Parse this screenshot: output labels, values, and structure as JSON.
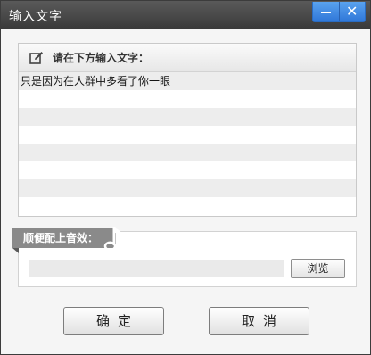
{
  "window": {
    "title": "输入文字",
    "minimize_icon": "minimize-icon",
    "close_icon": "close-icon",
    "accent": "#3a86e0"
  },
  "text_panel": {
    "header_icon": "edit-icon",
    "header_label": "请在下方输入文字：",
    "lines": [
      "只是因为在人群中多看了你一眼",
      "",
      "",
      "",
      "",
      "",
      "",
      ""
    ]
  },
  "music_panel": {
    "tag_label": "顺便配上音效：",
    "tag_icon": "music-note-icon",
    "path_value": "",
    "browse_label": "浏览"
  },
  "buttons": {
    "ok_label": "确定",
    "cancel_label": "取消"
  }
}
